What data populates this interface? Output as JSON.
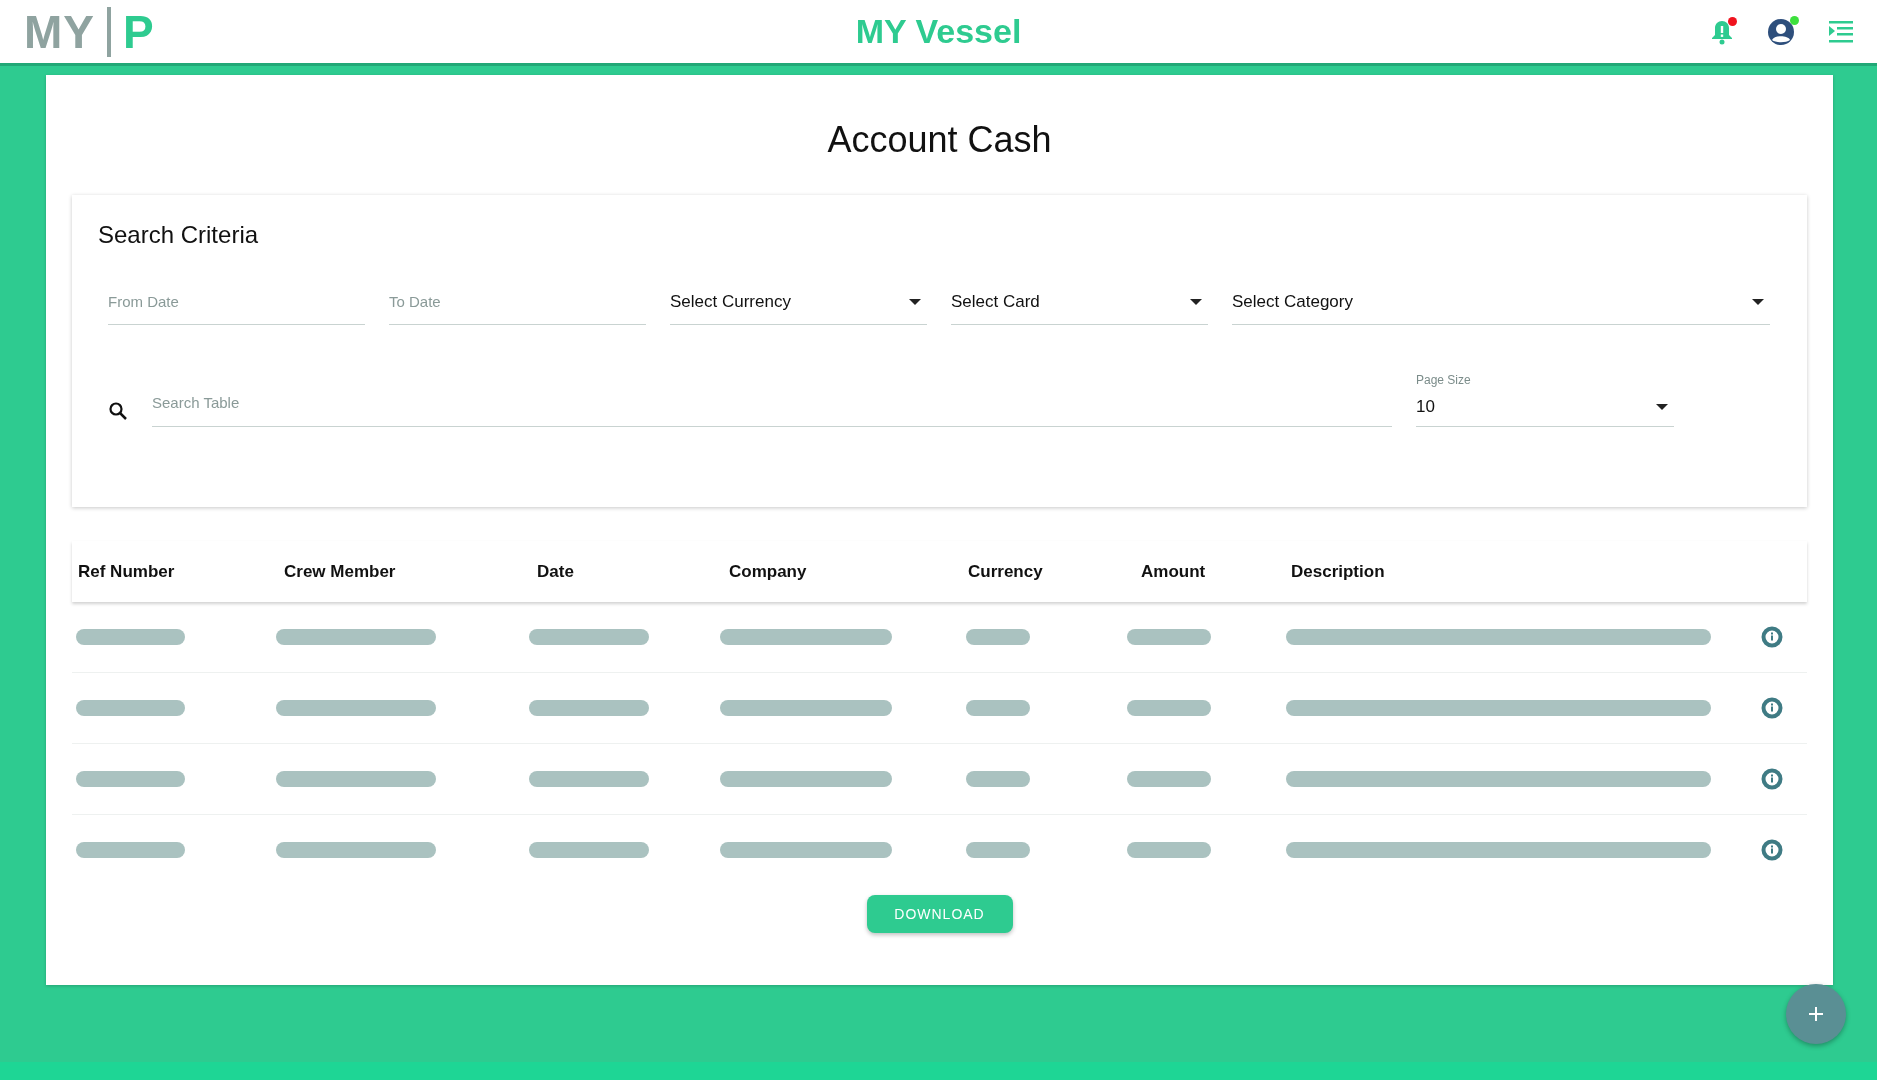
{
  "header": {
    "logo_left": "MY",
    "logo_right": "P",
    "title": "MY Vessel",
    "notifications_unread": true,
    "user_online": true
  },
  "page": {
    "title": "Account Cash"
  },
  "search_criteria": {
    "title": "Search Criteria",
    "filters": [
      {
        "kind": "date",
        "placeholder": "From Date"
      },
      {
        "kind": "date",
        "placeholder": "To Date"
      },
      {
        "kind": "select",
        "value": "Select Currency"
      },
      {
        "kind": "select",
        "value": "Select Card"
      },
      {
        "kind": "select",
        "value": "Select Category"
      }
    ],
    "search": {
      "placeholder": "Search Table"
    },
    "page_size": {
      "label": "Page Size",
      "value": "10"
    }
  },
  "table": {
    "columns": [
      "Ref Number",
      "Crew Member",
      "Date",
      "Company",
      "Currency",
      "Amount",
      "Description"
    ],
    "rows": [
      {
        "loading": true
      },
      {
        "loading": true
      },
      {
        "loading": true
      },
      {
        "loading": true
      }
    ]
  },
  "download_button": "DOWNLOAD"
}
